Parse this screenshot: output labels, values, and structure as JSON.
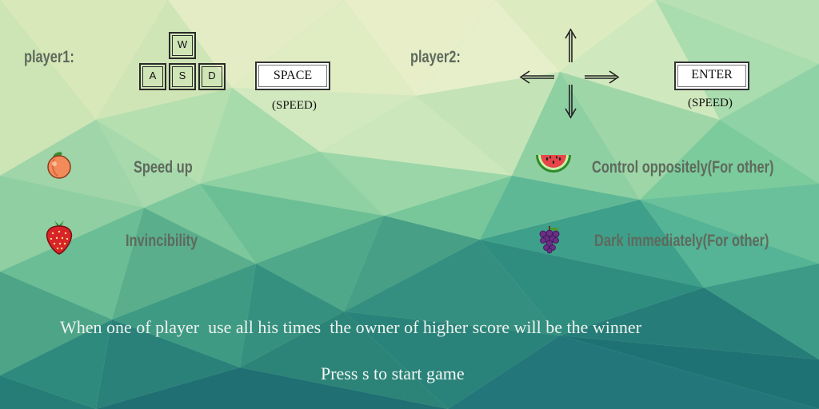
{
  "player1": {
    "label": "player1:",
    "keys": [
      "W",
      "A",
      "S",
      "D"
    ],
    "speed_key": "SPACE",
    "speed_caption": "(SPEED)"
  },
  "player2": {
    "label": "player2:",
    "arrows": [
      "arrow-up-icon",
      "arrow-left-icon",
      "arrow-right-icon",
      "arrow-down-icon"
    ],
    "speed_key": "ENTER",
    "speed_caption": "(SPEED)"
  },
  "items": [
    {
      "icon": "peach-icon",
      "text": "Speed up"
    },
    {
      "icon": "strawberry-icon",
      "text": "Invincibility"
    },
    {
      "icon": "watermelon-icon",
      "text": "Control oppositely(For other)"
    },
    {
      "icon": "grape-icon",
      "text": "Dark immediately(For other)"
    }
  ],
  "rule_text": "When one of player  use all his times  the owner of higher score will be the winner",
  "start_text": "Press s to start game",
  "colors": {
    "bg_light": "#e6edc8",
    "bg_mid": "#6cc79a",
    "bg_dark": "#1e6f73",
    "label": "#5e6a5c"
  }
}
